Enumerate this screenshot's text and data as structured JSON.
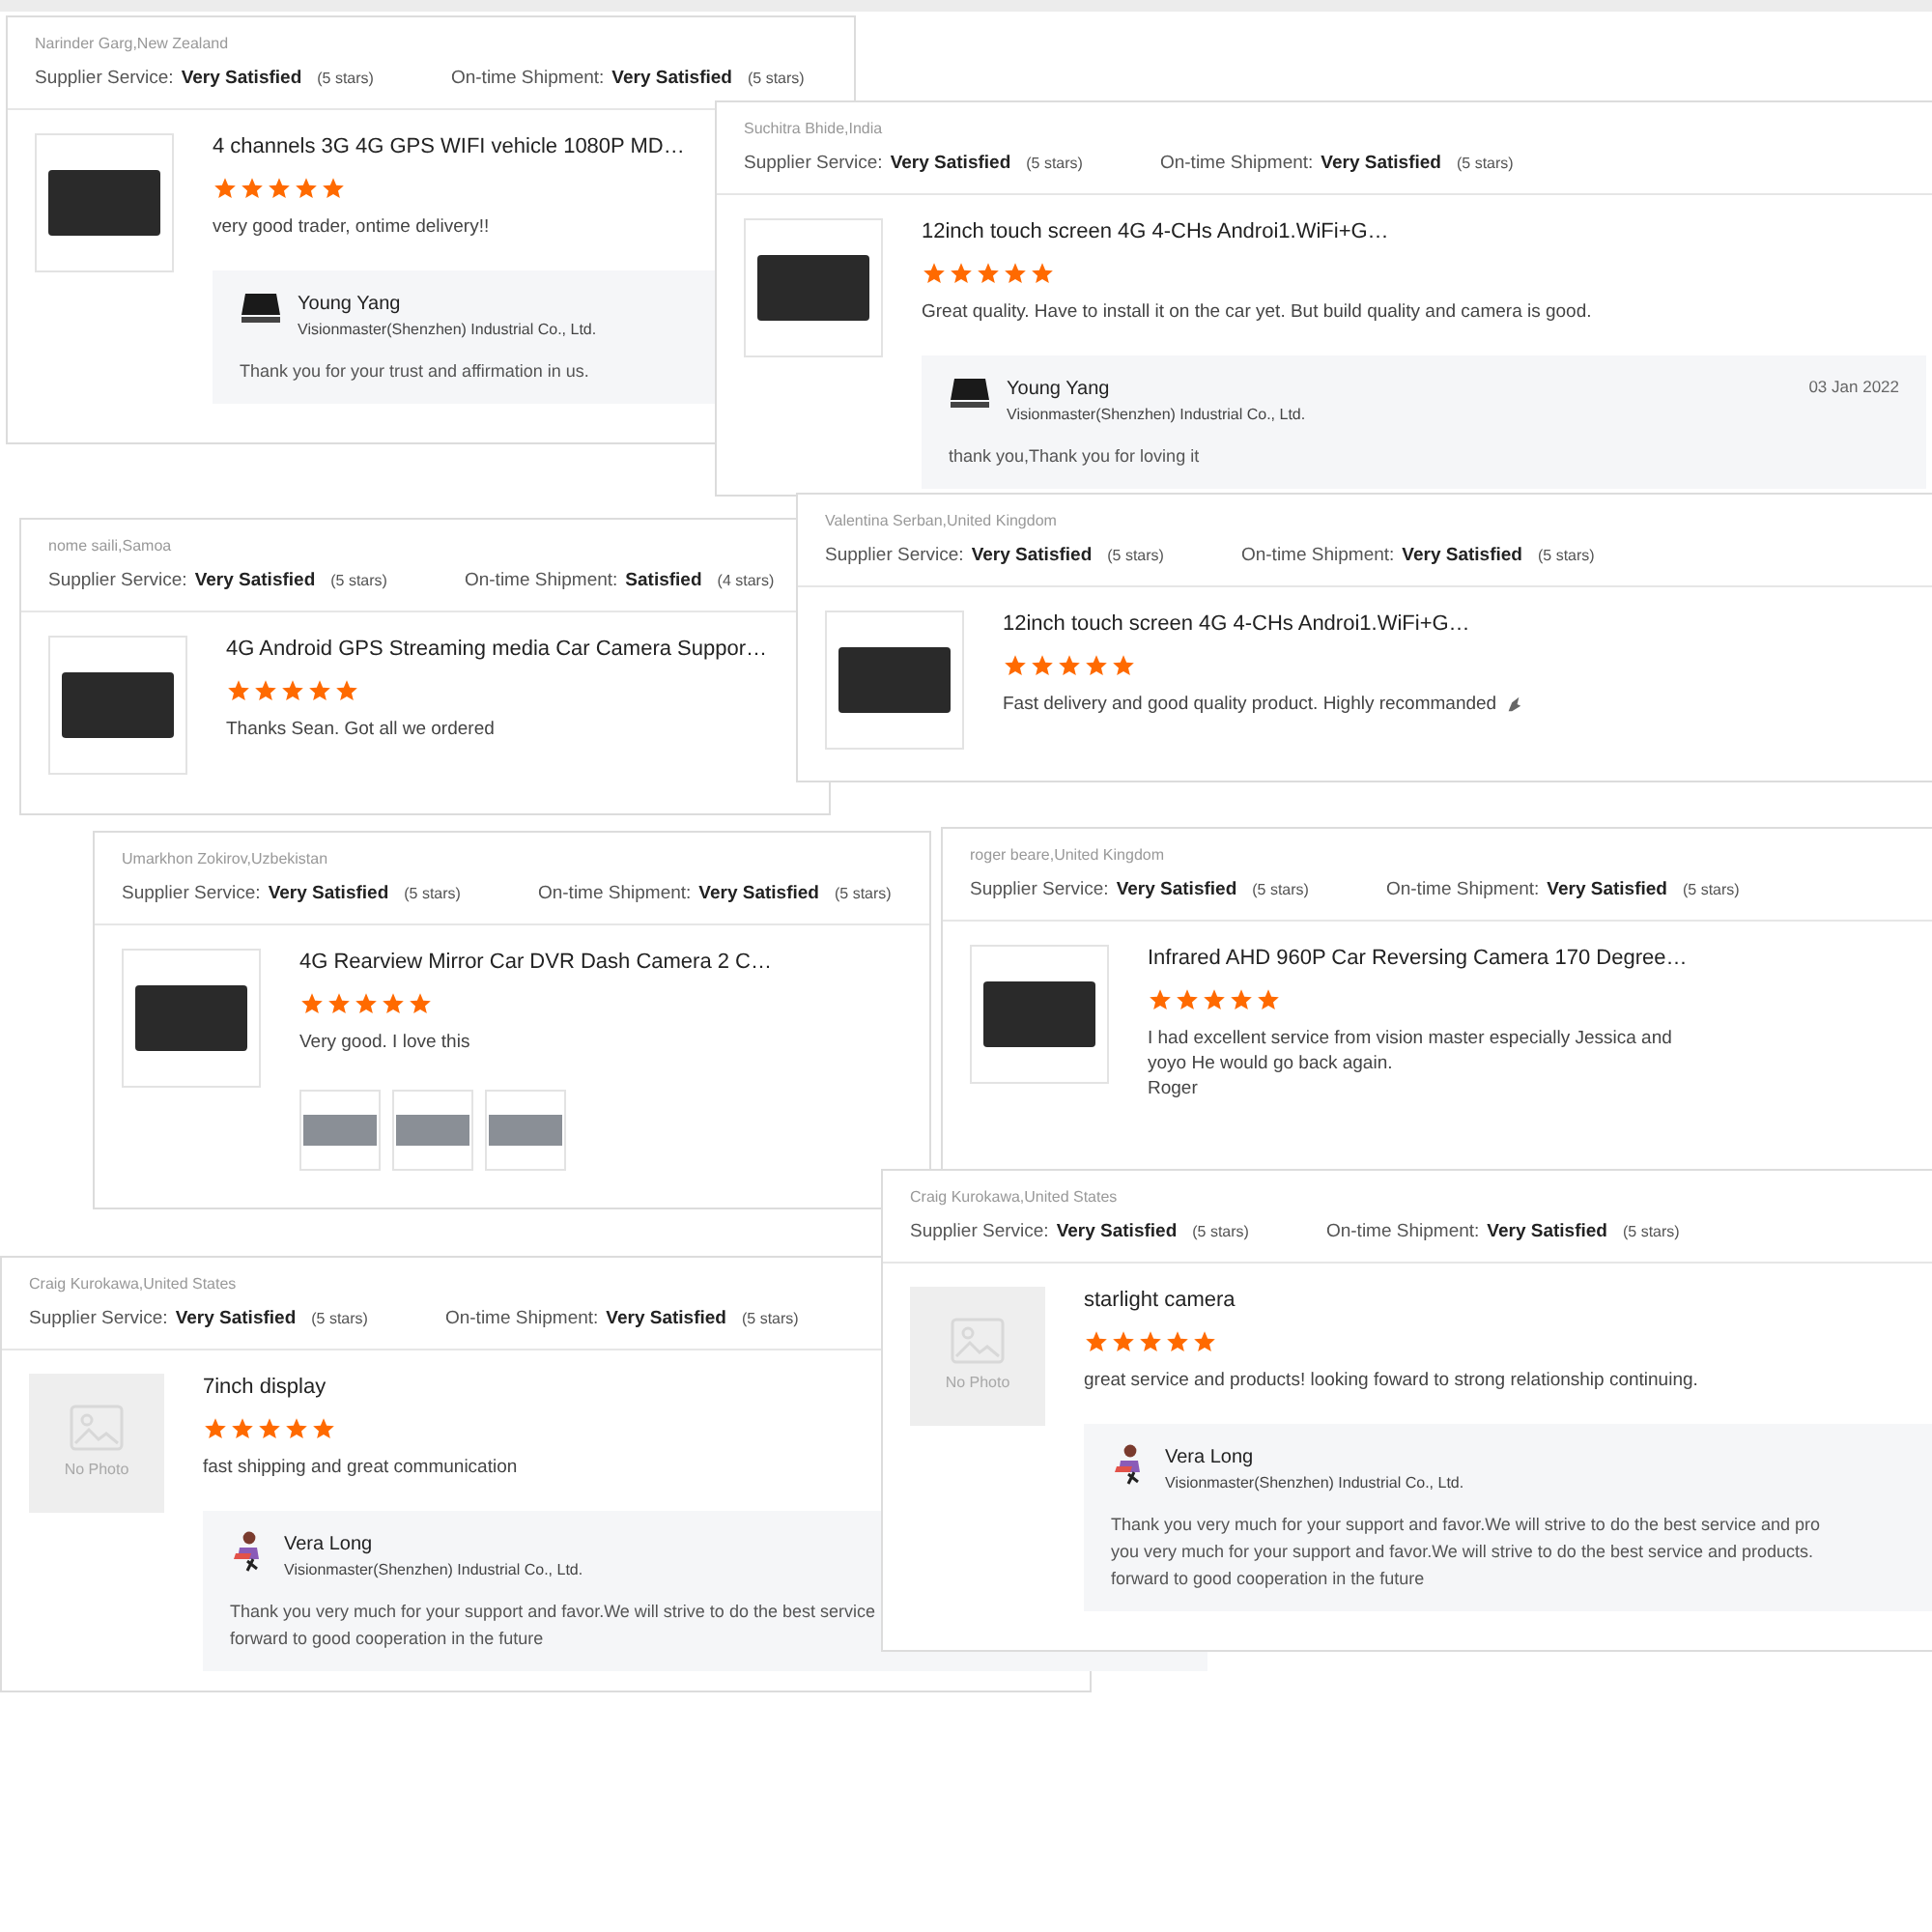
{
  "cards": [
    {
      "reviewer": "Narinder Garg,New Zealand",
      "ratings": [
        {
          "label": "Supplier Service:",
          "value": "Very Satisfied",
          "count": "(5 stars)"
        },
        {
          "label": "On-time Shipment:",
          "value": "Very Satisfied",
          "count": "(5 stars)"
        }
      ],
      "title": "4 channels 3G 4G GPS WIFI vehicle 1080P MD…",
      "stars": 5,
      "review": [
        "very good trader, ontime delivery!!"
      ],
      "reply": {
        "name": "Young Yang",
        "company": "Visionmaster(Shenzhen) Industrial Co., Ltd.",
        "text": [
          "Thank you for your trust and affirmation in us."
        ]
      }
    },
    {
      "reviewer": "Suchitra Bhide,India",
      "ratings": [
        {
          "label": "Supplier Service:",
          "value": "Very Satisfied",
          "count": "(5 stars)"
        },
        {
          "label": "On-time Shipment:",
          "value": "Very Satisfied",
          "count": "(5 stars)"
        }
      ],
      "title": "12inch touch screen 4G 4-CHs Androi1.WiFi+G…",
      "stars": 5,
      "review": [
        "Great quality. Have to install it on the car yet. But build quality and camera is good."
      ],
      "reply": {
        "name": "Young Yang",
        "company": "Visionmaster(Shenzhen) Industrial Co., Ltd.",
        "date": "03 Jan 2022",
        "text": [
          "thank  you,Thank you for loving it"
        ]
      }
    },
    {
      "reviewer": "nome saili,Samoa",
      "ratings": [
        {
          "label": "Supplier Service:",
          "value": "Very Satisfied",
          "count": "(5 stars)"
        },
        {
          "label": "On-time Shipment:",
          "value": "Satisfied",
          "count": "(4 stars)"
        }
      ],
      "title": "4G Android GPS Streaming media Car Camera Suppor…",
      "stars": 5,
      "review": [
        "Thanks Sean. Got all we ordered"
      ]
    },
    {
      "reviewer": "Valentina Serban,United Kingdom",
      "ratings": [
        {
          "label": "Supplier Service:",
          "value": "Very Satisfied",
          "count": "(5 stars)"
        },
        {
          "label": "On-time Shipment:",
          "value": "Very Satisfied",
          "count": "(5 stars)"
        }
      ],
      "title": "12inch touch screen 4G 4-CHs Androi1.WiFi+G…",
      "stars": 5,
      "review": [
        "Fast delivery and good quality product. Highly recommanded"
      ]
    },
    {
      "reviewer": "Umarkhon Zokirov,Uzbekistan",
      "ratings": [
        {
          "label": "Supplier Service:",
          "value": "Very Satisfied",
          "count": "(5 stars)"
        },
        {
          "label": "On-time Shipment:",
          "value": "Very Satisfied",
          "count": "(5 stars)"
        }
      ],
      "title": "4G Rearview Mirror Car DVR Dash Camera 2 C…",
      "stars": 5,
      "review": [
        "Very good. I love this"
      ]
    },
    {
      "reviewer": "roger beare,United Kingdom",
      "ratings": [
        {
          "label": "Supplier Service:",
          "value": "Very Satisfied",
          "count": "(5 stars)"
        },
        {
          "label": "On-time Shipment:",
          "value": "Very Satisfied",
          "count": "(5 stars)"
        }
      ],
      "title": "Infrared AHD 960P Car Reversing Camera 170 Degree…",
      "stars": 5,
      "review": [
        "I had excellent service from vision master especially Jessica and",
        "yoyo He would go back again.",
        "Roger"
      ]
    },
    {
      "reviewer": "Craig Kurokawa,United States",
      "ratings": [
        {
          "label": "Supplier Service:",
          "value": "Very Satisfied",
          "count": "(5 stars)"
        },
        {
          "label": "On-time Shipment:",
          "value": "Very Satisfied",
          "count": "(5 stars)"
        }
      ],
      "image_text": "No Photo",
      "title": "7inch display",
      "stars": 5,
      "review": [
        "fast shipping and great communication"
      ],
      "reply": {
        "name": "Vera Long",
        "company": "Visionmaster(Shenzhen) Industrial Co., Ltd.",
        "text": [
          "Thank you very much for your support and favor.We will strive to do the best service",
          "forward to good cooperation in the future"
        ]
      }
    },
    {
      "reviewer": "Craig Kurokawa,United States",
      "ratings": [
        {
          "label": "Supplier Service:",
          "value": "Very Satisfied",
          "count": "(5 stars)"
        },
        {
          "label": "On-time Shipment:",
          "value": "Very Satisfied",
          "count": "(5 stars)"
        }
      ],
      "image_text": "No Photo",
      "title": "starlight camera",
      "stars": 5,
      "review": [
        "great service and products! looking foward to strong relationship  continuing."
      ],
      "reply": {
        "name": "Vera Long",
        "company": "Visionmaster(Shenzhen) Industrial Co., Ltd.",
        "text": [
          "Thank you very much for your support and favor.We will strive to do the best service and pro",
          "you very much for your support and favor.We will strive to do the best service and products.",
          "forward to good cooperation in the future"
        ]
      }
    }
  ]
}
